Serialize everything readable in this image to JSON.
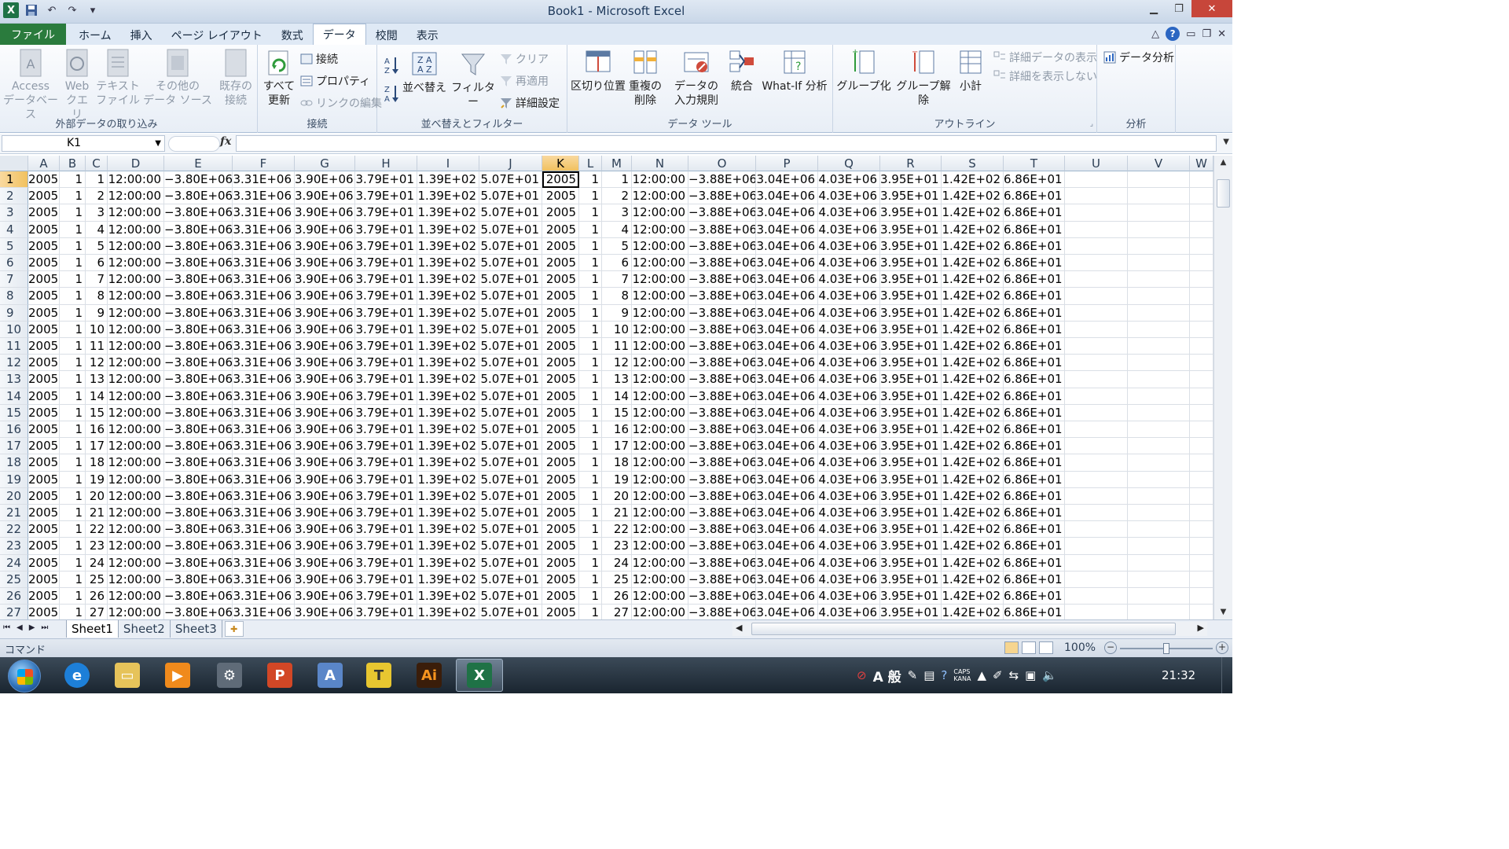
{
  "window": {
    "title": "Book1 - Microsoft Excel",
    "app_icon": "excel-icon"
  },
  "tabs": [
    "ファイル",
    "ホーム",
    "挿入",
    "ページ レイアウト",
    "数式",
    "データ",
    "校閲",
    "表示"
  ],
  "active_tab": "データ",
  "ribbon": {
    "groups": [
      {
        "name": "外部データの取り込み",
        "buttons": [
          "Access データベース",
          "Web クエリ",
          "テキスト ファイル",
          "その他の データ ソース"
        ]
      },
      {
        "name": "接続",
        "buttons": [
          "既存の 接続",
          "すべて 更新",
          "接続",
          "プロパティ",
          "リンクの編集"
        ]
      },
      {
        "name": "並べ替えとフィルター",
        "buttons": [
          "並べ替え",
          "フィルター",
          "クリア",
          "再適用",
          "詳細設定"
        ]
      },
      {
        "name": "データ ツール",
        "buttons": [
          "区切り位置",
          "重複の 削除",
          "データの 入力規則",
          "統合",
          "What-If 分析"
        ]
      },
      {
        "name": "アウトライン",
        "buttons": [
          "グループ化",
          "グループ解除",
          "小計",
          "詳細データの表示",
          "詳細を表示しない"
        ]
      },
      {
        "name": "分析",
        "buttons": [
          "データ分析"
        ]
      }
    ],
    "labels": {
      "access": "Access",
      "access2": "データベース",
      "web": "Web",
      "web2": "クエリ",
      "text": "テキスト",
      "text2": "ファイル",
      "other": "その他の",
      "other2": "データ ソース",
      "existing": "既存の",
      "existing2": "接続",
      "refresh": "すべて",
      "refresh2": "更新",
      "conn": "接続",
      "props": "プロパティ",
      "editlinks": "リンクの編集",
      "sort": "並べ替え",
      "filter": "フィルター",
      "clear": "クリア",
      "reapply": "再適用",
      "advanced": "詳細設定",
      "t2c": "区切り位置",
      "dup": "重複の",
      "dup2": "削除",
      "dv": "データの",
      "dv2": "入力規則",
      "consol": "統合",
      "whatif": "What-If 分析",
      "group": "グループ化",
      "ungroup": "グループ解除",
      "subtotal": "小計",
      "showdetail": "詳細データの表示",
      "hidedetail": "詳細を表示しない",
      "analysis": "データ分析"
    }
  },
  "formula_bar": {
    "name_box": "K1",
    "fx": "fx",
    "formula": ""
  },
  "grid": {
    "columns": [
      "A",
      "B",
      "C",
      "D",
      "E",
      "F",
      "G",
      "H",
      "I",
      "J",
      "K",
      "L",
      "M",
      "N",
      "O",
      "P",
      "Q",
      "R",
      "S",
      "T",
      "U",
      "V",
      "W"
    ],
    "selected_column": "K",
    "active_cell": "K1",
    "row_template": [
      "2005",
      "1",
      "{n}",
      "12:00:00",
      "−3.80E+06",
      "3.31E+06",
      "3.90E+06",
      "3.79E+01",
      "1.39E+02",
      "5.07E+01",
      "2005",
      "1",
      "{n}",
      "12:00:00",
      "−3.88E+06",
      "3.04E+06",
      "4.03E+06",
      "3.95E+01",
      "1.42E+02",
      "6.86E+01",
      "",
      "",
      ""
    ],
    "row_count": 27
  },
  "sheet_tabs": [
    "Sheet1",
    "Sheet2",
    "Sheet3"
  ],
  "active_sheet": "Sheet1",
  "status": {
    "mode": "コマンド",
    "zoom": "100%"
  },
  "taskbar": {
    "apps": [
      "internet-explorer",
      "file-explorer",
      "media-player",
      "network",
      "powerpoint",
      "word",
      "text-editor",
      "illustrator",
      "excel"
    ],
    "ime": "A 般",
    "clock": "21:32",
    "caps": "CAPS",
    "kana": "KANA"
  },
  "colors": {
    "file_tab": "#2a7b3d",
    "selected_header": "#f1c15f",
    "excel_green": "#1f7246"
  }
}
